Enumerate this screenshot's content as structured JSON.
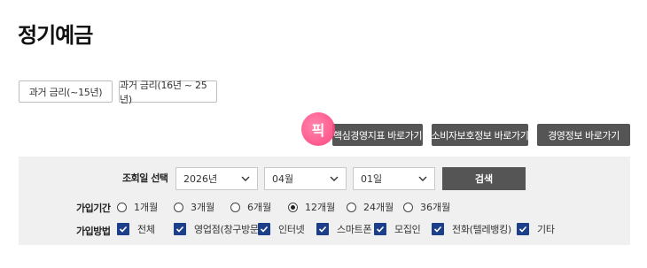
{
  "page": {
    "title": "정기예금"
  },
  "history_buttons": [
    "과거 금리(~15년)",
    "과거 금리(16년 ~ 25년)"
  ],
  "link_buttons": [
    "핵심경영지표 바로가기",
    "소비자보호정보 바로가기",
    "경영정보 바로가기"
  ],
  "badge": {
    "text": "픽",
    "color": "#ff4e86"
  },
  "search": {
    "date_label": "조회일 선택",
    "year": "2026년",
    "month": "04월",
    "day": "01일",
    "button_label": "검색"
  },
  "period": {
    "label": "가입기간",
    "options": [
      "1개월",
      "3개월",
      "6개월",
      "12개월",
      "24개월",
      "36개월"
    ],
    "selected": "12개월"
  },
  "method": {
    "label": "가입방법",
    "options": [
      "전체",
      "영업점(창구방문)",
      "인터넷",
      "스마트폰",
      "모집인",
      "전화(텔레뱅킹)",
      "기타"
    ],
    "all_checked": true
  },
  "colors": {
    "button_dark": "#555555",
    "checkbox": "#1d3f8a",
    "panel_bg": "#f0f0f0"
  }
}
